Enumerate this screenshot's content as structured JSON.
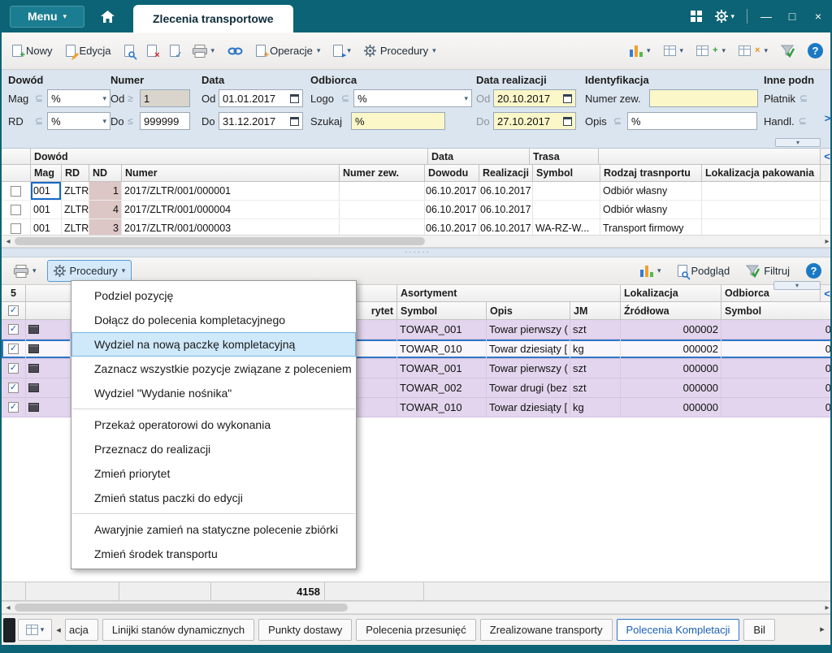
{
  "colors": {
    "titlebar": "#0c6375",
    "accent": "#2e75c6",
    "filter_bg": "#dbe5ef",
    "yellow_field": "#fbf7c9",
    "lavender_row": "#e3d5ed",
    "nd_cell": "#dcc6c6"
  },
  "titlebar": {
    "menu": "Menu",
    "tab": "Zlecenia transportowe"
  },
  "toolbar": {
    "nowy": "Nowy",
    "edycja": "Edycja",
    "operacje": "Operacje",
    "procedury": "Procedury"
  },
  "filters": {
    "groups": {
      "dowod": "Dowód",
      "numer": "Numer",
      "data": "Data",
      "odbiorca": "Odbiorca",
      "data_realizacji": "Data realizacji",
      "identyfikacja": "Identyfikacja",
      "inne": "Inne podn"
    },
    "mag": {
      "label": "Mag",
      "op": "⊆",
      "value": "%"
    },
    "rd": {
      "label": "RD",
      "op": "⊆",
      "value": "%"
    },
    "numer_od": {
      "label": "Od",
      "op": "≥",
      "value": "1"
    },
    "numer_do": {
      "label": "Do",
      "op": "≤",
      "value": "999999"
    },
    "data_od": {
      "label": "Od",
      "value": "01.01.2017"
    },
    "data_do": {
      "label": "Do",
      "value": "31.12.2017"
    },
    "logo": {
      "label": "Logo",
      "op": "⊆",
      "value": "%"
    },
    "szukaj": {
      "label": "Szukaj",
      "value": "%"
    },
    "real_od": {
      "label": "Od",
      "value": "20.10.2017"
    },
    "real_do": {
      "label": "Do",
      "value": "27.10.2017"
    },
    "numer_zew": {
      "label": "Numer zew.",
      "value": ""
    },
    "opis": {
      "label": "Opis",
      "op": "⊆",
      "value": "%"
    },
    "platnik": {
      "label": "Płatnik",
      "op": "⊆"
    },
    "handl": {
      "label": "Handl.",
      "op": "⊆"
    }
  },
  "upper_grid": {
    "groups": {
      "dowod": "Dowód",
      "data": "Data",
      "trasa": "Trasa"
    },
    "columns": {
      "mag": "Mag",
      "rd": "RD",
      "nd": "ND",
      "numer": "Numer",
      "numer_zew": "Numer zew.",
      "dowodu": "Dowodu",
      "realizacji": "Realizacji",
      "symbol": "Symbol",
      "rodzaj": "Rodzaj trasnportu",
      "lokalizacja": "Lokalizacja pakowania"
    },
    "rows": [
      {
        "mag": "001",
        "rd": "ZLTR",
        "nd": "1",
        "numer": "2017/ZLTR/001/000001",
        "dowodu": "06.10.2017",
        "realizacji": "06.10.2017",
        "rodzaj": "Odbiór własny"
      },
      {
        "mag": "001",
        "rd": "ZLTR",
        "nd": "4",
        "numer": "2017/ZLTR/001/000004",
        "dowodu": "06.10.2017",
        "realizacji": "06.10.2017",
        "rodzaj": "Odbiór własny"
      },
      {
        "mag": "001",
        "rd": "ZLTR",
        "nd": "3",
        "numer": "2017/ZLTR/001/000003",
        "dowodu": "06.10.2017",
        "realizacji": "06.10.2017",
        "symbol": "WA-RZ-W...",
        "rodzaj": "Transport firmowy"
      }
    ]
  },
  "lower_toolbar": {
    "procedury": "Procedury",
    "podglad": "Podgląd",
    "filtruj": "Filtruj"
  },
  "context_menu": {
    "items": [
      "Podziel pozycję",
      "Dołącz do polecenia kompletacyjnego",
      "Wydziel na nową paczkę kompletacyjną",
      "Zaznacz wszystkie pozycje związane z poleceniem",
      "Wydziel \"Wydanie nośnika\"",
      "Przekaż operatorowi do wykonania",
      "Przeznacz do realizacji",
      "Zmień priorytet",
      "Zmień status paczki do edycji",
      "Awaryjnie zamień na statyczne polecenie zbiórki",
      "Zmień środek transportu"
    ]
  },
  "lower_grid": {
    "count": "5",
    "groups": {
      "asortyment": "Asortyment",
      "lokalizacja": "Lokalizacja",
      "odbiorca": "Odbiorca"
    },
    "columns": {
      "priorytet": "rytet",
      "symbol": "Symbol",
      "opis": "Opis",
      "jm": "JM",
      "zrodlowa": "Źródłowa",
      "odb_symbol": "Symbol"
    },
    "rows": [
      {
        "symbol": "TOWAR_001",
        "opis": "Towar pierwszy (",
        "jm": "szt",
        "zrodlowa": "000002",
        "odbiorca": "0"
      },
      {
        "symbol": "TOWAR_010",
        "opis": "Towar dziesiąty [",
        "jm": "kg",
        "zrodlowa": "000002",
        "odbiorca": "0"
      },
      {
        "symbol": "TOWAR_001",
        "opis": "Towar pierwszy (",
        "jm": "szt",
        "zrodlowa": "000000",
        "odbiorca": "0"
      },
      {
        "symbol": "TOWAR_002",
        "opis": "Towar drugi (bez",
        "jm": "szt",
        "zrodlowa": "000000",
        "odbiorca": "0"
      },
      {
        "symbol": "TOWAR_010",
        "opis": "Towar dziesiąty [",
        "jm": "kg",
        "zrodlowa": "000000",
        "odbiorca": "0"
      }
    ],
    "summary": "4158"
  },
  "bottom_tabs": [
    "acja",
    "Linijki stanów dynamicznych",
    "Punkty dostawy",
    "Polecenia przesunięć",
    "Zrealizowane transporty",
    "Polecenia Kompletacji",
    "Bil"
  ],
  "icons": {
    "chevron": "▾",
    "left_small": "◂",
    "right_small": "▸",
    "nav_left": "<",
    "nav_right": ">",
    "minimize": "—",
    "maximize": "□",
    "close": "×",
    "help": "?",
    "check": "✓",
    "plus": "+",
    "cross": "×",
    "grip": "······"
  }
}
